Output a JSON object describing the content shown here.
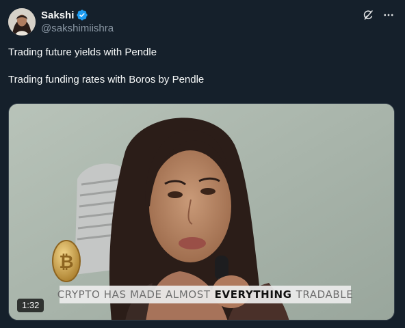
{
  "author": {
    "display_name": "Sakshi",
    "handle": "@sakshimiishra",
    "verified": true
  },
  "tweet": {
    "lines": [
      "Trading future yields with Pendle",
      "Trading funding rates with Boros by Pendle"
    ]
  },
  "media": {
    "type": "video",
    "duration": "1:32",
    "caption_before": "CRYPTO HAS MADE ALMOST",
    "caption_highlight": "EVERYTHING",
    "caption_after": "TRADABLE"
  },
  "icons": {
    "grok": "grok-icon",
    "more": "more-options-icon",
    "verified": "verified-badge-icon"
  },
  "colors": {
    "background": "#15202b",
    "text_primary": "#f7f9f9",
    "text_secondary": "#8b98a5",
    "verified_blue": "#1d9bf0"
  }
}
